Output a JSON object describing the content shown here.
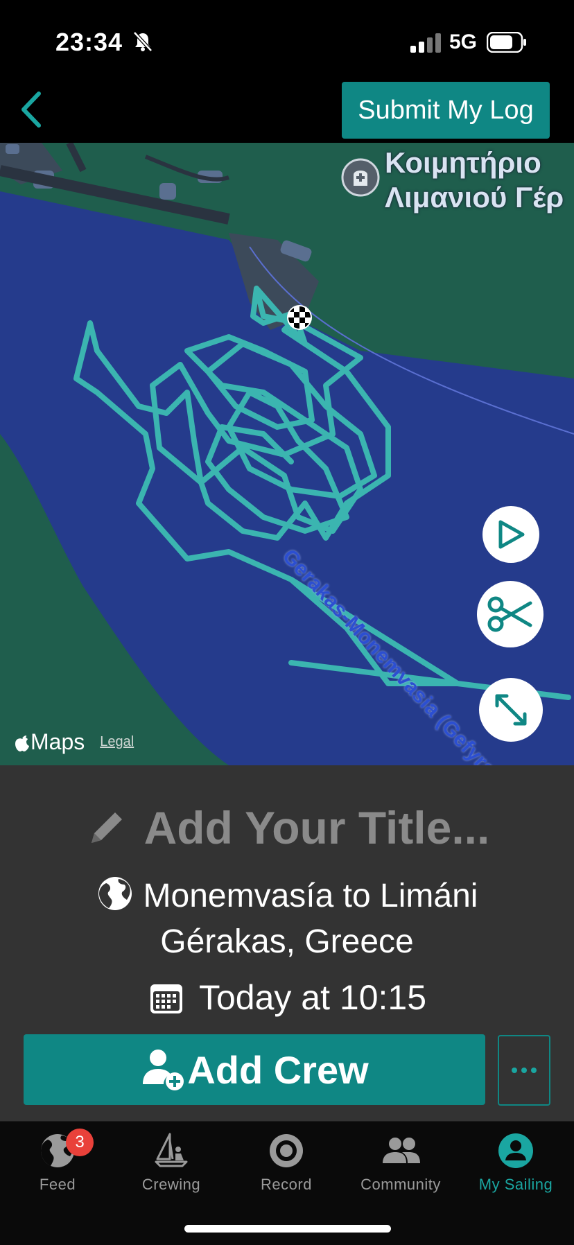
{
  "status_bar": {
    "time": "23:34",
    "network": "5G",
    "icons": [
      "bell-slash-icon",
      "signal-icon",
      "battery-icon"
    ]
  },
  "nav": {
    "back_icon": "chevron-left-icon",
    "submit_label": "Submit My Log"
  },
  "map": {
    "poi_line1": "Κοιμητήριο",
    "poi_line2": "Λιμανιού Γέρ",
    "poi_icon": "cemetery-icon",
    "road_label": "Gerakas-Monemvasia (Gefyra)",
    "attribution": "Maps",
    "legal_label": "Legal",
    "controls": [
      "play-icon",
      "scissors-icon",
      "expand-icon"
    ],
    "colors": {
      "water": "#253b8c",
      "land": "#1f5e4d",
      "track": "#3bb5b0"
    }
  },
  "log": {
    "title_placeholder": "Add Your Title...",
    "location": "Monemvasía to Limáni Gérakas, Greece",
    "date": "Today at 10:15",
    "add_crew_label": "Add Crew",
    "more_label": "..."
  },
  "tabs": [
    {
      "label": "Feed",
      "icon": "globe-icon",
      "badge": "3"
    },
    {
      "label": "Crewing",
      "icon": "sailboat-icon"
    },
    {
      "label": "Record",
      "icon": "record-icon"
    },
    {
      "label": "Community",
      "icon": "people-icon"
    },
    {
      "label": "My Sailing",
      "icon": "user-icon",
      "active": true
    }
  ],
  "colors": {
    "accent": "#0f8784",
    "active_tab": "#1aa6a1",
    "badge": "#e9413a"
  }
}
